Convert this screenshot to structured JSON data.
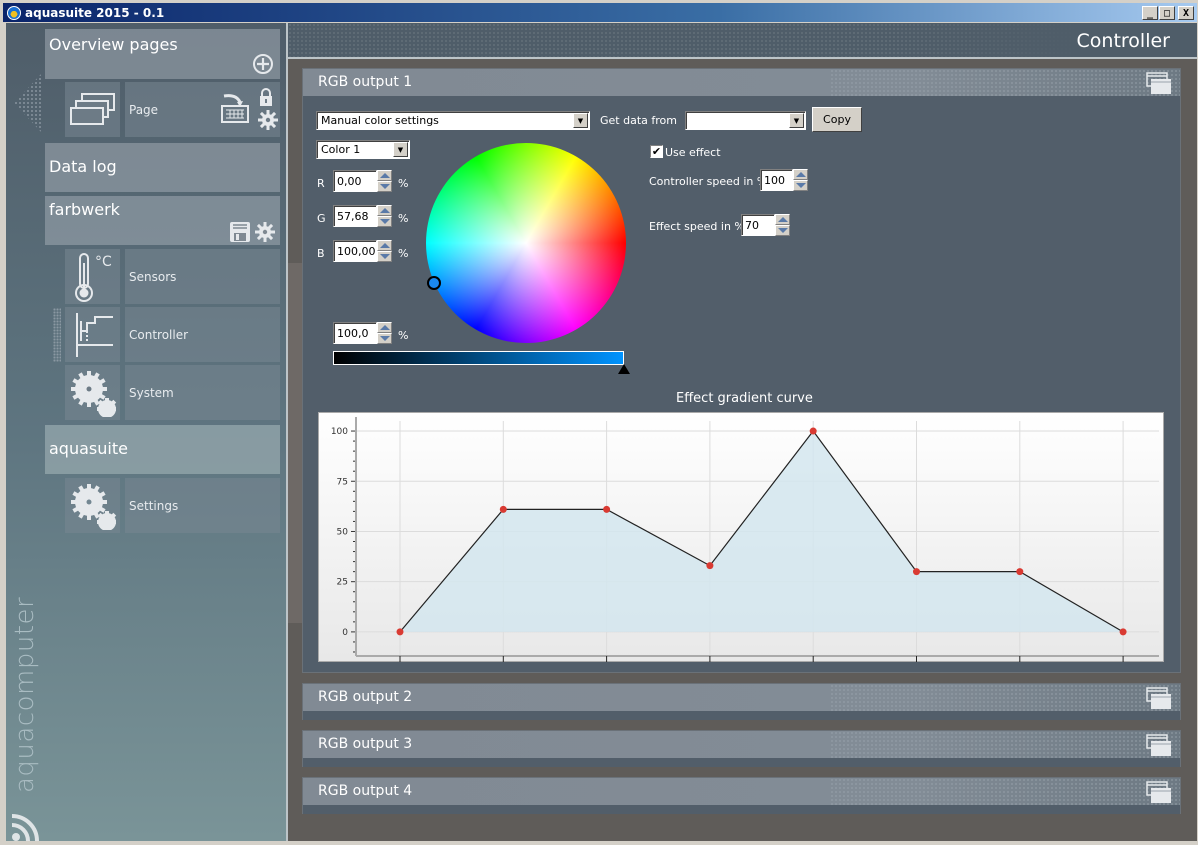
{
  "window": {
    "title": "aquasuite 2015 - 0.1",
    "buttons": [
      "_",
      "□",
      "X"
    ]
  },
  "sidebar": {
    "overview": {
      "label": "Overview pages",
      "icon": "add-circle-icon"
    },
    "page": {
      "label": "Page",
      "icon": "pages-icon",
      "action_icons": [
        "monitor-import-icon",
        "lock-icon",
        "gear-icon"
      ]
    },
    "data_log": {
      "label": "Data log"
    },
    "device": {
      "label": "farbwerk",
      "action_icons": [
        "save-icon",
        "gear-icon"
      ]
    },
    "device_items": [
      {
        "label": "Sensors",
        "icon": "thermometer-icon",
        "unit": "°C"
      },
      {
        "label": "Controller",
        "icon": "controller-curve-icon",
        "active": true
      },
      {
        "label": "System",
        "icon": "gears-icon"
      }
    ],
    "app": {
      "label": "aquasuite"
    },
    "app_items": [
      {
        "label": "Settings",
        "icon": "gears-icon"
      }
    ],
    "brand": "aquacomputer"
  },
  "main": {
    "title": "Controller",
    "panels": [
      {
        "label": "RGB output 1",
        "expanded": true
      },
      {
        "label": "RGB output 2",
        "expanded": false
      },
      {
        "label": "RGB output 3",
        "expanded": false
      },
      {
        "label": "RGB output 4",
        "expanded": false
      }
    ],
    "rgb1": {
      "mode": "Manual color settings",
      "get_data_label": "Get data from",
      "get_data_value": "",
      "copy_label": "Copy",
      "color_select": "Color 1",
      "r_label": "R",
      "r_value": "0,00",
      "g_label": "G",
      "g_value": "57,68",
      "b_label": "B",
      "b_value": "100,00",
      "percent": "%",
      "brightness_value": "100,0",
      "brightness_fraction": 1.0,
      "selected_color": "#0093ff",
      "use_effect_label": "Use effect",
      "use_effect_checked": true,
      "controller_speed_label": "Controller speed in %",
      "controller_speed_value": "100",
      "effect_speed_label": "Effect speed in %",
      "effect_speed_value": "70"
    }
  },
  "chart_data": {
    "type": "area",
    "title": "Effect gradient curve",
    "x": [
      1,
      2,
      3,
      4,
      5,
      6,
      7,
      8
    ],
    "values": [
      0,
      61,
      61,
      33,
      100,
      30,
      30,
      0
    ],
    "ylim": [
      -12,
      105
    ],
    "yticks": [
      0,
      25,
      50,
      75,
      100
    ],
    "xlabel": "",
    "ylabel": "",
    "grid": true,
    "line_color": "#222222",
    "point_color": "#d93a32",
    "fill_color": "#d3e6ee"
  }
}
